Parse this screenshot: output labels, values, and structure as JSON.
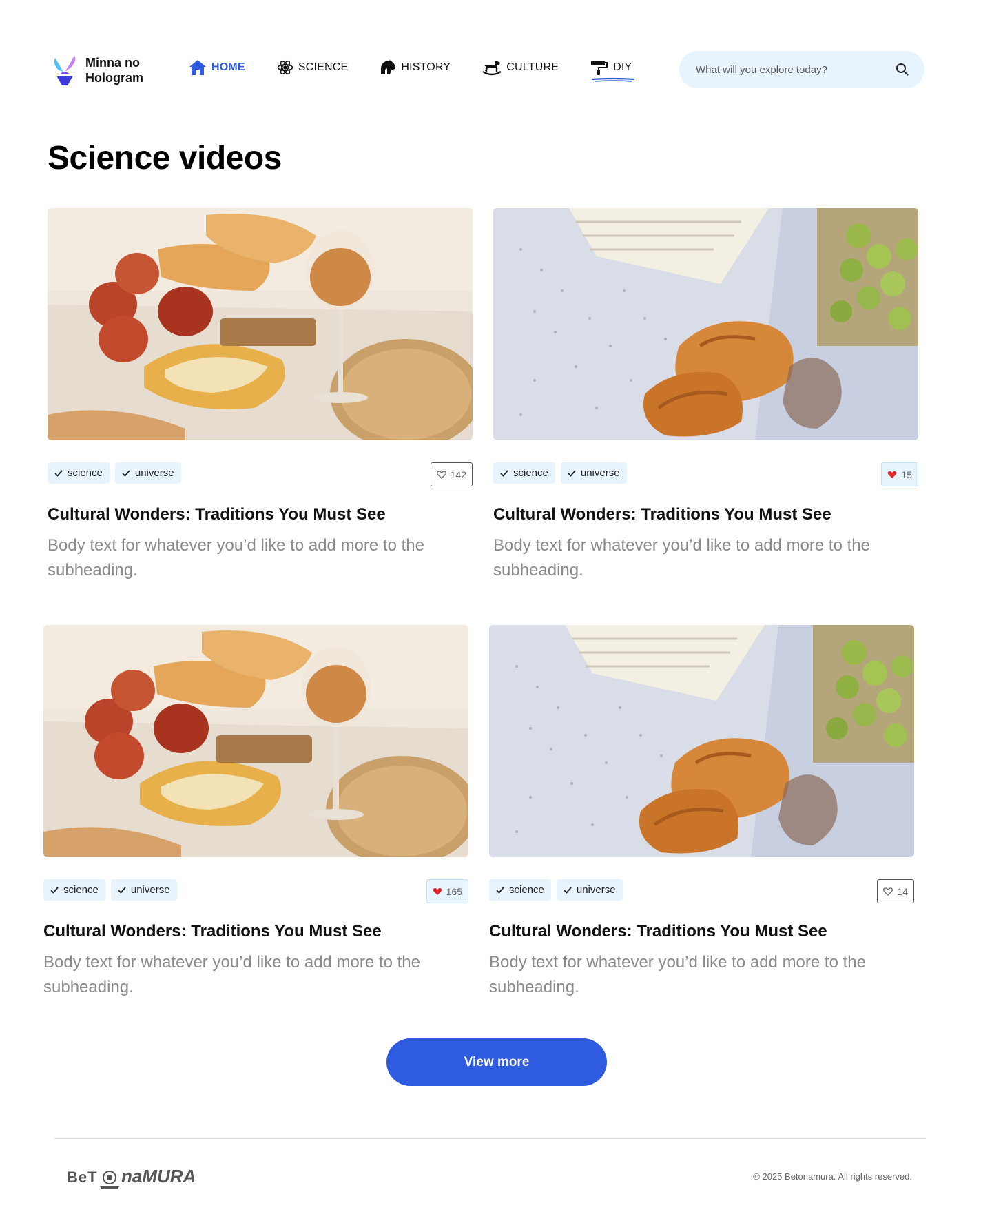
{
  "brand": {
    "line1": "Minna no",
    "line2": "Hologram"
  },
  "nav": [
    {
      "label": "HOME",
      "icon": "home-icon",
      "active": true
    },
    {
      "label": "SCIENCE",
      "icon": "atom-icon",
      "active": false
    },
    {
      "label": "HISTORY",
      "icon": "spartan-helmet-icon",
      "active": false
    },
    {
      "label": "CULTURE",
      "icon": "rocking-horse-icon",
      "active": false
    },
    {
      "label": "DIY",
      "icon": "paint-roller-icon",
      "active": false
    }
  ],
  "search": {
    "placeholder": "What will you explore today?",
    "value": ""
  },
  "page_title": "Science videos",
  "cards": [
    {
      "image": "peaches-bread-wine-photo",
      "tags": [
        "science",
        "universe"
      ],
      "likes": "142",
      "liked": false,
      "title": "Cultural Wonders: Traditions You Must See",
      "body": "Body text for whatever you’d like to add more to the subheading."
    },
    {
      "image": "croissants-grapes-book-photo",
      "tags": [
        "science",
        "universe"
      ],
      "likes": "15",
      "liked": true,
      "title": "Cultural Wonders: Traditions You Must See",
      "body": "Body text for whatever you’d like to add more to the subheading."
    },
    {
      "image": "peaches-bread-wine-photo",
      "tags": [
        "science",
        "universe"
      ],
      "likes": "165",
      "liked": true,
      "title": "Cultural Wonders: Traditions You Must See",
      "body": "Body text for whatever you’d like to add more to the subheading."
    },
    {
      "image": "croissants-grapes-book-photo",
      "tags": [
        "science",
        "universe"
      ],
      "likes": "14",
      "liked": false,
      "title": "Cultural Wonders: Traditions You Must See",
      "body": "Body text for whatever you’d like to add more to the subheading."
    }
  ],
  "view_more": "View more",
  "footer": {
    "logo_text": "BeTonaMURA",
    "copyright": "© 2025 Betonamura. All rights reserved."
  },
  "colors": {
    "accent": "#2e5be0",
    "tag_bg": "#e8f4fd",
    "heart": "#e0262b"
  }
}
